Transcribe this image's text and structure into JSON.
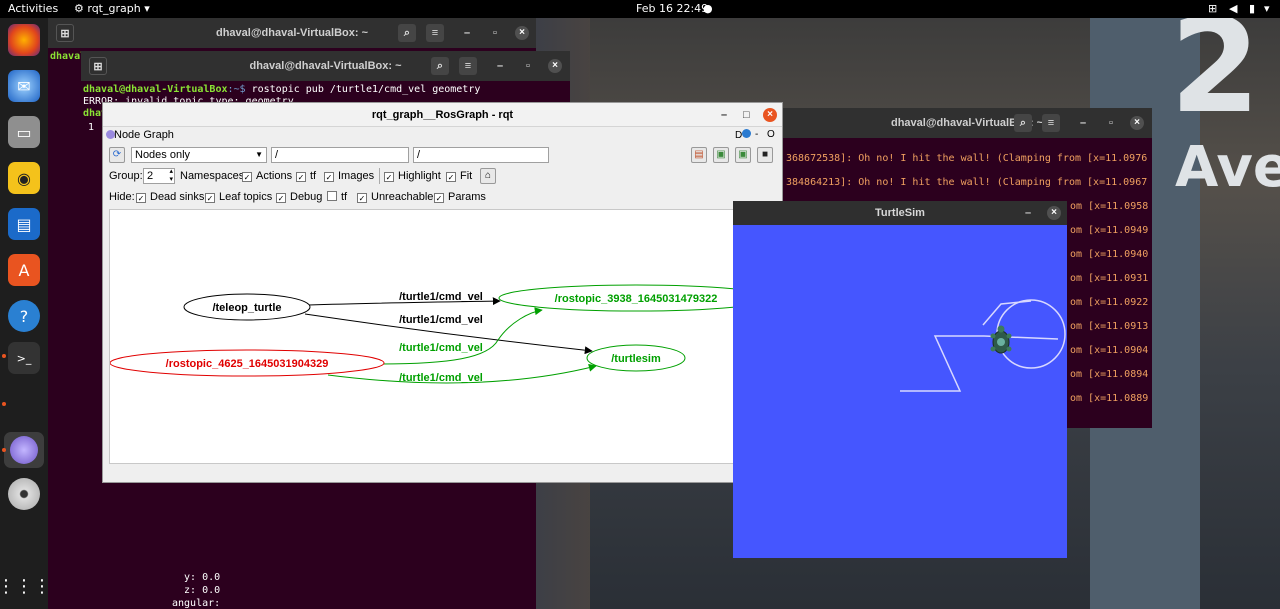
{
  "topbar": {
    "activities": "Activities",
    "app": "rqt_graph",
    "clock": "Feb 16  22:49"
  },
  "terminal_back": {
    "title": "dhaval@dhaval-VirtualBox: ~",
    "prompt_fragment": "dhaval",
    "bottom_lines": [
      "  y: 0.0",
      "  z: 0.0",
      "angular:"
    ]
  },
  "terminal_mid": {
    "title": "dhaval@dhaval-VirtualBox: ~",
    "prompt_user": "dhaval@dhaval-VirtualBox",
    "prompt_path": ":~$ ",
    "command": "rostopic pub /turtle1/cmd_vel geometry",
    "error_line": "ERROR: invalid topic type: geometry",
    "prompt_fragment": "dhav",
    "cursor_number": "1"
  },
  "terminal_right": {
    "title": "dhaval@dhaval-VirtualBox: ~",
    "lines": [
      "368672538]: Oh no! I hit the wall! (Clamping from [x=11.0976",
      "384864213]: Oh no! I hit the wall! (Clamping from [x=11.0967",
      "om [x=11.0958",
      "om [x=11.0949",
      "om [x=11.0940",
      "om [x=11.0931",
      "om [x=11.0922",
      "om [x=11.0913",
      "om [x=11.0904",
      "om [x=11.0894",
      "om [x=11.0889"
    ]
  },
  "rqt": {
    "title": "rqt_graph__RosGraph - rqt",
    "plugin": "Node Graph",
    "header_help": "D",
    "header_close": "O",
    "filter_mode": "Nodes only",
    "filter1": "/",
    "filter2": "/",
    "group_label": "Group:",
    "group_value": "2",
    "options": [
      {
        "label": "Namespaces",
        "checked": true
      },
      {
        "label": "Actions",
        "checked": true
      },
      {
        "label": "tf",
        "checked": true
      },
      {
        "label": "Images",
        "checked": true
      },
      {
        "label": "Highlight",
        "checked": true
      },
      {
        "label": "Fit",
        "checked": true
      }
    ],
    "hide_label": "Hide:",
    "hide": [
      {
        "label": "Dead sinks",
        "checked": true
      },
      {
        "label": "Leaf topics",
        "checked": true
      },
      {
        "label": "Debug",
        "checked": true
      },
      {
        "label": "tf",
        "checked": false
      },
      {
        "label": "Unreachable",
        "checked": true
      },
      {
        "label": "Params",
        "checked": true
      }
    ],
    "graph": {
      "nodes": {
        "teleop": "/teleop_turtle",
        "rostopic3938": "/rostopic_3938_1645031479322",
        "rostopic4625": "/rostopic_4625_1645031904329",
        "turtlesim": "/turtlesim"
      },
      "edges": [
        "/turtle1/cmd_vel",
        "/turtle1/cmd_vel",
        "/turtle1/cmd_vel",
        "/turtle1/cmd_vel"
      ],
      "colors": {
        "black": "#000000",
        "green": "#00a000",
        "red": "#e00000"
      }
    }
  },
  "turtlesim": {
    "title": "TurtleSim",
    "background": "#4556ff"
  },
  "wallpaper_text": {
    "big": "2",
    "small": "Ave"
  }
}
